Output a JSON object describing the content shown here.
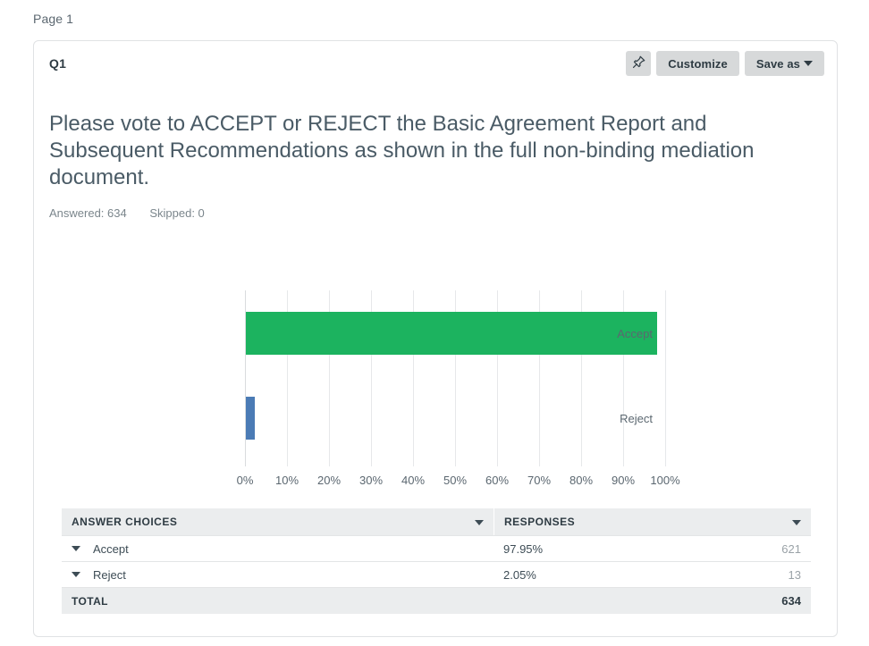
{
  "page_label": "Page 1",
  "card": {
    "question_number": "Q1",
    "question_text": "Please vote to ACCEPT or REJECT the Basic Agreement Report and Subsequent Recommendations as shown in the full non-binding mediation document.",
    "answered_label": "Answered: 634",
    "skipped_label": "Skipped: 0"
  },
  "toolbar": {
    "pin_icon": "pushpin-icon",
    "customize_label": "Customize",
    "save_as_label": "Save as"
  },
  "chart_data": {
    "type": "bar",
    "orientation": "horizontal",
    "title": "",
    "xlabel": "",
    "ylabel": "",
    "categories": [
      "Accept",
      "Reject"
    ],
    "values": [
      97.95,
      2.05
    ],
    "value_suffix": "%",
    "colors": [
      "#1CB35F",
      "#4B7BB5"
    ],
    "xlim": [
      0,
      100
    ],
    "xticks": [
      "0%",
      "10%",
      "20%",
      "30%",
      "40%",
      "50%",
      "60%",
      "70%",
      "80%",
      "90%",
      "100%"
    ],
    "xtick_values": [
      0,
      10,
      20,
      30,
      40,
      50,
      60,
      70,
      80,
      90,
      100
    ],
    "grid": true,
    "legend": false
  },
  "table": {
    "columns": [
      "ANSWER CHOICES",
      "RESPONSES"
    ],
    "rows": [
      {
        "choice": "Accept",
        "percent": "97.95%",
        "count": "621"
      },
      {
        "choice": "Reject",
        "percent": "2.05%",
        "count": "13"
      }
    ],
    "total_label": "TOTAL",
    "total_count": "634"
  }
}
